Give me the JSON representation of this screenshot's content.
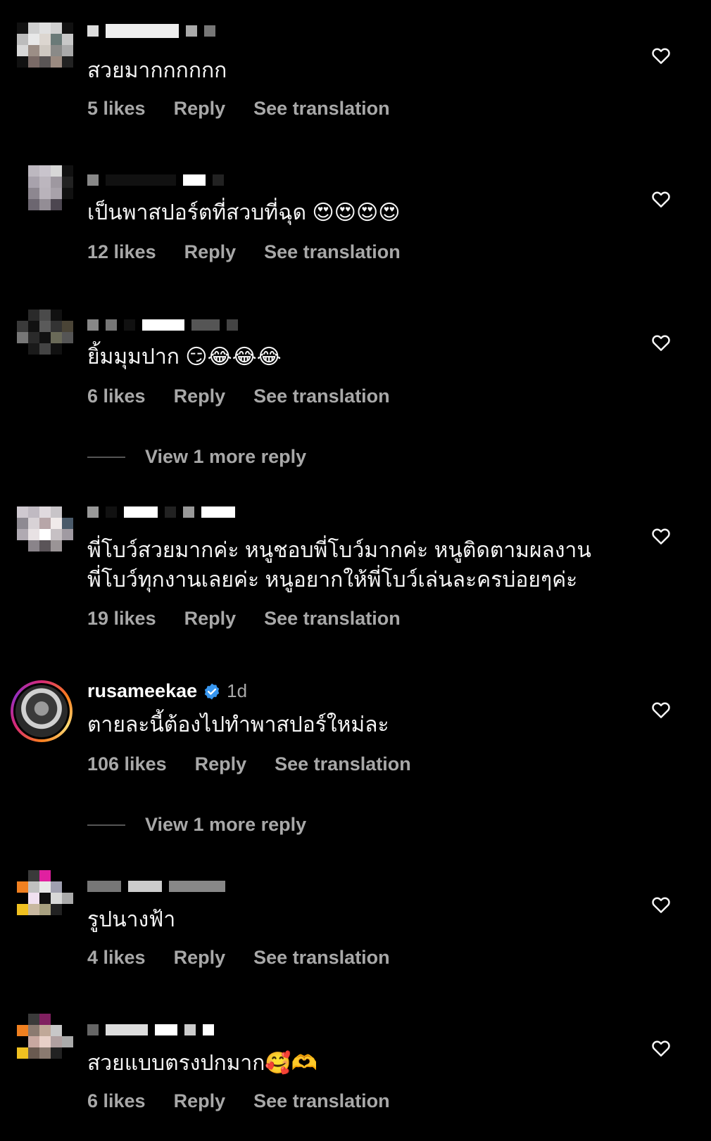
{
  "comments": [
    {
      "text": "สวยมากกกกกก",
      "likes": "5 likes",
      "reply": "Reply",
      "translate": "See translation"
    },
    {
      "text": "เป็นพาสปอร์ตที่สวบที่ฉุด 😍😍😍😍",
      "likes": "12 likes",
      "reply": "Reply",
      "translate": "See translation"
    },
    {
      "text": "ยิ้มมุมปาก 😏😂😂😂",
      "likes": "6 likes",
      "reply": "Reply",
      "translate": "See translation",
      "view_more": "View 1 more reply"
    },
    {
      "text_line1": "พี่โบว์สวยมากค่ะ หนูชอบพี่โบว์มากค่ะ หนูติดตามผลงาน",
      "text_line2": "พี่โบว์ทุกงานเลยค่ะ หนูอยากให้พี่โบว์เล่นละครบ่อยๆค่ะ",
      "likes": "19 likes",
      "reply": "Reply",
      "translate": "See translation"
    },
    {
      "username": "rusameekae",
      "time": "1d",
      "text": "ตายละนี้ต้องไปทำพาสปอร์ใหม่ละ",
      "likes": "106 likes",
      "reply": "Reply",
      "translate": "See translation",
      "view_more": "View 1 more reply"
    },
    {
      "text": "รูปนางฟ้า",
      "likes": "4 likes",
      "reply": "Reply",
      "translate": "See translation"
    },
    {
      "text": "สวยแบบตรงปกมาก🥰🫶",
      "likes": "6 likes",
      "reply": "Reply",
      "translate": "See translation"
    }
  ],
  "colors": {
    "background": "#000000",
    "text": "#f5f5f5",
    "secondary": "#a8a8a8",
    "verified": "#3897f0"
  },
  "icons": {
    "like": "heart-outline-icon",
    "verified": "verified-badge-icon"
  }
}
